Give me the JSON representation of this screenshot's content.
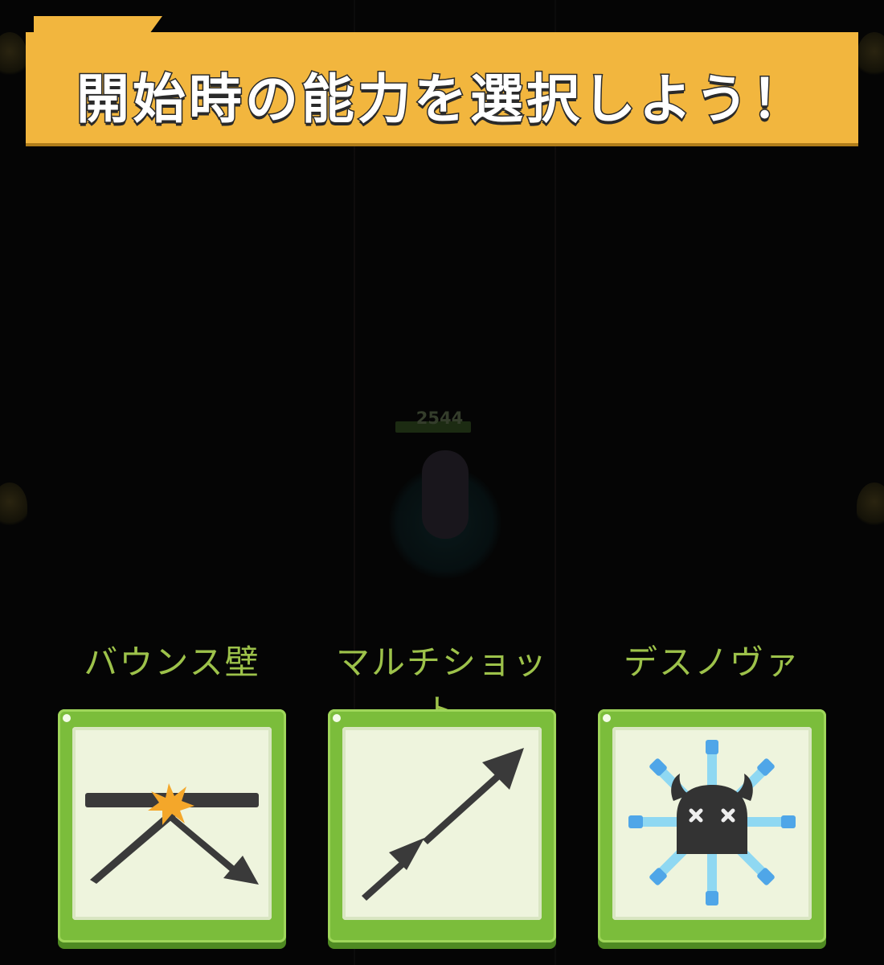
{
  "banner": {
    "title": "開始時の能力を選択しよう！"
  },
  "enemy": {
    "hp": "2544"
  },
  "skills": [
    {
      "label": "バウンス壁",
      "icon": "bounce-wall-icon"
    },
    {
      "label": "マルチショット",
      "icon": "multishot-arrow-icon"
    },
    {
      "label": "デスノヴァ",
      "icon": "death-nova-skull-icon"
    }
  ],
  "colors": {
    "banner": "#f2b63e",
    "label": "#9dc24a",
    "card_border": "#7bbd3b",
    "card_face": "#eef4dd",
    "icon_dark": "#3a3a3a",
    "spark": "#f4a72a",
    "nova_ray": "#6ec8ee"
  }
}
